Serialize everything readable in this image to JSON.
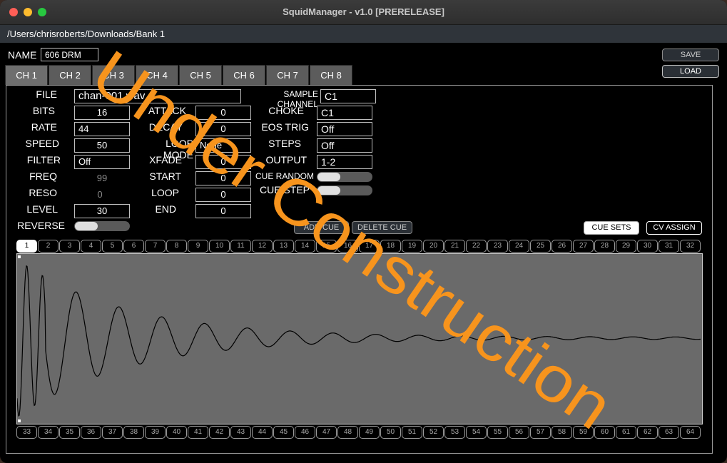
{
  "window": {
    "title": "SquidManager - v1.0 [PRERELEASE]",
    "path": "/Users/chrisroberts/Downloads/Bank 1"
  },
  "header": {
    "name_label": "NAME",
    "name_value": "606 DRM",
    "save_label": "SAVE",
    "load_label": "LOAD"
  },
  "tabs": [
    "CH 1",
    "CH 2",
    "CH 3",
    "CH 4",
    "CH 5",
    "CH 6",
    "CH 7",
    "CH 8"
  ],
  "left": {
    "file_label": "FILE",
    "file_value": "chan-001.wav",
    "bits_label": "BITS",
    "bits_value": "16",
    "rate_label": "RATE",
    "rate_value": "44",
    "speed_label": "SPEED",
    "speed_value": "50",
    "filter_label": "FILTER",
    "filter_value": "Off",
    "freq_label": "FREQ",
    "freq_value": "99",
    "reso_label": "RESO",
    "reso_value": "0",
    "level_label": "LEVEL",
    "level_value": "30",
    "reverse_label": "REVERSE"
  },
  "middle": {
    "attack_label": "ATTACK",
    "attack_value": "0",
    "decay_label": "DECAY",
    "decay_value": "0",
    "loopmode_label": "LOOP MODE",
    "loopmode_value": "None",
    "xfade_label": "XFADE",
    "xfade_value": "0",
    "start_label": "START",
    "start_value": "0",
    "loop_label": "LOOP",
    "loop_value": "0",
    "end_label": "END",
    "end_value": "0"
  },
  "right": {
    "samplech_label": "SAMPLE CHANNEL",
    "samplech_value": "C1",
    "choke_label": "CHOKE",
    "choke_value": "C1",
    "eos_label": "EOS TRIG",
    "eos_value": "Off",
    "steps_label": "STEPS",
    "steps_value": "Off",
    "output_label": "OUTPUT",
    "output_value": "1-2",
    "cuerandom_label": "CUE RANDOM",
    "cuestep_label": "CUE STEP"
  },
  "buttons": {
    "add_cue": "ADD CUE",
    "delete_cue": "DELETE CUE",
    "cue_sets": "CUE SETS",
    "cv_assign": "CV ASSIGN"
  },
  "cues_top": [
    "1",
    "2",
    "3",
    "4",
    "5",
    "6",
    "7",
    "8",
    "9",
    "10",
    "11",
    "12",
    "13",
    "14",
    "15",
    "16",
    "17",
    "18",
    "19",
    "20",
    "21",
    "22",
    "23",
    "24",
    "25",
    "26",
    "27",
    "28",
    "29",
    "30",
    "31",
    "32"
  ],
  "cues_bottom": [
    "33",
    "34",
    "35",
    "36",
    "37",
    "38",
    "39",
    "40",
    "41",
    "42",
    "43",
    "44",
    "45",
    "46",
    "47",
    "48",
    "49",
    "50",
    "51",
    "52",
    "53",
    "54",
    "55",
    "56",
    "57",
    "58",
    "59",
    "60",
    "61",
    "62",
    "63",
    "64"
  ],
  "selected_cue": "1",
  "watermark": "Under Construction",
  "colors": {
    "watermark": "#f7941d",
    "waveform_bg": "#6a6a6a",
    "tab": "#5c5c5c"
  }
}
